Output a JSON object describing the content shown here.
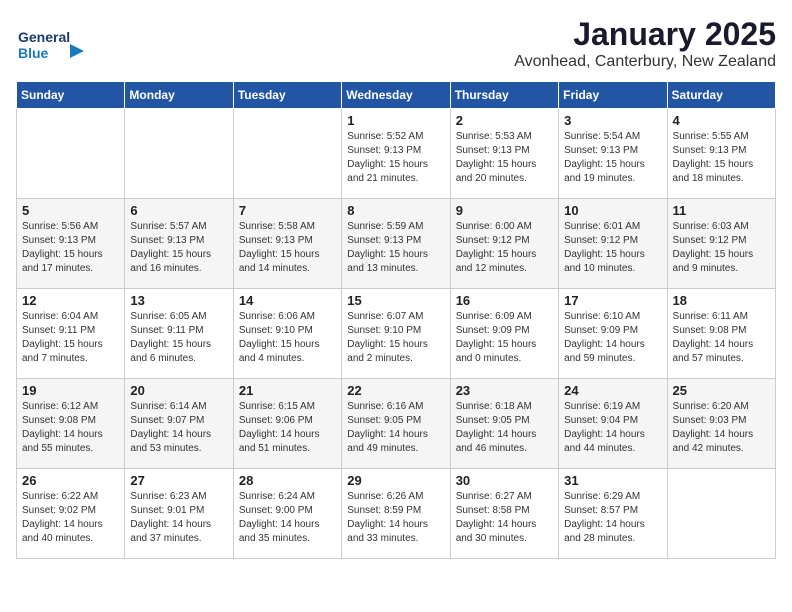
{
  "header": {
    "logo_general": "General",
    "logo_blue": "Blue",
    "month": "January 2025",
    "location": "Avonhead, Canterbury, New Zealand"
  },
  "days_of_week": [
    "Sunday",
    "Monday",
    "Tuesday",
    "Wednesday",
    "Thursday",
    "Friday",
    "Saturday"
  ],
  "weeks": [
    [
      {
        "num": "",
        "info": ""
      },
      {
        "num": "",
        "info": ""
      },
      {
        "num": "",
        "info": ""
      },
      {
        "num": "1",
        "info": "Sunrise: 5:52 AM\nSunset: 9:13 PM\nDaylight: 15 hours\nand 21 minutes."
      },
      {
        "num": "2",
        "info": "Sunrise: 5:53 AM\nSunset: 9:13 PM\nDaylight: 15 hours\nand 20 minutes."
      },
      {
        "num": "3",
        "info": "Sunrise: 5:54 AM\nSunset: 9:13 PM\nDaylight: 15 hours\nand 19 minutes."
      },
      {
        "num": "4",
        "info": "Sunrise: 5:55 AM\nSunset: 9:13 PM\nDaylight: 15 hours\nand 18 minutes."
      }
    ],
    [
      {
        "num": "5",
        "info": "Sunrise: 5:56 AM\nSunset: 9:13 PM\nDaylight: 15 hours\nand 17 minutes."
      },
      {
        "num": "6",
        "info": "Sunrise: 5:57 AM\nSunset: 9:13 PM\nDaylight: 15 hours\nand 16 minutes."
      },
      {
        "num": "7",
        "info": "Sunrise: 5:58 AM\nSunset: 9:13 PM\nDaylight: 15 hours\nand 14 minutes."
      },
      {
        "num": "8",
        "info": "Sunrise: 5:59 AM\nSunset: 9:13 PM\nDaylight: 15 hours\nand 13 minutes."
      },
      {
        "num": "9",
        "info": "Sunrise: 6:00 AM\nSunset: 9:12 PM\nDaylight: 15 hours\nand 12 minutes."
      },
      {
        "num": "10",
        "info": "Sunrise: 6:01 AM\nSunset: 9:12 PM\nDaylight: 15 hours\nand 10 minutes."
      },
      {
        "num": "11",
        "info": "Sunrise: 6:03 AM\nSunset: 9:12 PM\nDaylight: 15 hours\nand 9 minutes."
      }
    ],
    [
      {
        "num": "12",
        "info": "Sunrise: 6:04 AM\nSunset: 9:11 PM\nDaylight: 15 hours\nand 7 minutes."
      },
      {
        "num": "13",
        "info": "Sunrise: 6:05 AM\nSunset: 9:11 PM\nDaylight: 15 hours\nand 6 minutes."
      },
      {
        "num": "14",
        "info": "Sunrise: 6:06 AM\nSunset: 9:10 PM\nDaylight: 15 hours\nand 4 minutes."
      },
      {
        "num": "15",
        "info": "Sunrise: 6:07 AM\nSunset: 9:10 PM\nDaylight: 15 hours\nand 2 minutes."
      },
      {
        "num": "16",
        "info": "Sunrise: 6:09 AM\nSunset: 9:09 PM\nDaylight: 15 hours\nand 0 minutes."
      },
      {
        "num": "17",
        "info": "Sunrise: 6:10 AM\nSunset: 9:09 PM\nDaylight: 14 hours\nand 59 minutes."
      },
      {
        "num": "18",
        "info": "Sunrise: 6:11 AM\nSunset: 9:08 PM\nDaylight: 14 hours\nand 57 minutes."
      }
    ],
    [
      {
        "num": "19",
        "info": "Sunrise: 6:12 AM\nSunset: 9:08 PM\nDaylight: 14 hours\nand 55 minutes."
      },
      {
        "num": "20",
        "info": "Sunrise: 6:14 AM\nSunset: 9:07 PM\nDaylight: 14 hours\nand 53 minutes."
      },
      {
        "num": "21",
        "info": "Sunrise: 6:15 AM\nSunset: 9:06 PM\nDaylight: 14 hours\nand 51 minutes."
      },
      {
        "num": "22",
        "info": "Sunrise: 6:16 AM\nSunset: 9:05 PM\nDaylight: 14 hours\nand 49 minutes."
      },
      {
        "num": "23",
        "info": "Sunrise: 6:18 AM\nSunset: 9:05 PM\nDaylight: 14 hours\nand 46 minutes."
      },
      {
        "num": "24",
        "info": "Sunrise: 6:19 AM\nSunset: 9:04 PM\nDaylight: 14 hours\nand 44 minutes."
      },
      {
        "num": "25",
        "info": "Sunrise: 6:20 AM\nSunset: 9:03 PM\nDaylight: 14 hours\nand 42 minutes."
      }
    ],
    [
      {
        "num": "26",
        "info": "Sunrise: 6:22 AM\nSunset: 9:02 PM\nDaylight: 14 hours\nand 40 minutes."
      },
      {
        "num": "27",
        "info": "Sunrise: 6:23 AM\nSunset: 9:01 PM\nDaylight: 14 hours\nand 37 minutes."
      },
      {
        "num": "28",
        "info": "Sunrise: 6:24 AM\nSunset: 9:00 PM\nDaylight: 14 hours\nand 35 minutes."
      },
      {
        "num": "29",
        "info": "Sunrise: 6:26 AM\nSunset: 8:59 PM\nDaylight: 14 hours\nand 33 minutes."
      },
      {
        "num": "30",
        "info": "Sunrise: 6:27 AM\nSunset: 8:58 PM\nDaylight: 14 hours\nand 30 minutes."
      },
      {
        "num": "31",
        "info": "Sunrise: 6:29 AM\nSunset: 8:57 PM\nDaylight: 14 hours\nand 28 minutes."
      },
      {
        "num": "",
        "info": ""
      }
    ]
  ]
}
